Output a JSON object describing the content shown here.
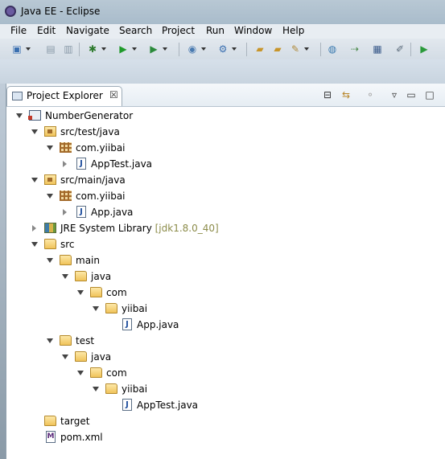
{
  "window": {
    "title": "Java EE - Eclipse"
  },
  "menu": [
    "File",
    "Edit",
    "Navigate",
    "Search",
    "Project",
    "Run",
    "Window",
    "Help"
  ],
  "toolbar": {
    "icons": [
      "new-icon",
      "save-icon",
      "save-all-icon",
      "debug-icon",
      "run-icon",
      "external-tools-icon",
      "new-server-icon",
      "web-service-icon",
      "open-folder-icon",
      "open-type-icon",
      "search-icon",
      "globe-icon",
      "next-annotation-icon",
      "console-icon",
      "pin-icon",
      "perspective-icon"
    ]
  },
  "view": {
    "tab_label": "Project Explorer",
    "close_glyph": "☒"
  },
  "tree": [
    {
      "label": "NumberGenerator",
      "icon": "project"
    },
    {
      "label": "src/test/java",
      "icon": "pkgroot"
    },
    {
      "label": "com.yiibai",
      "icon": "package"
    },
    {
      "label": "AppTest.java",
      "icon": "java"
    },
    {
      "label": "src/main/java",
      "icon": "pkgroot"
    },
    {
      "label": "com.yiibai",
      "icon": "package"
    },
    {
      "label": "App.java",
      "icon": "java"
    },
    {
      "label": "JRE System Library",
      "decoration": "[jdk1.8.0_40]",
      "icon": "library"
    },
    {
      "label": "src",
      "icon": "folder"
    },
    {
      "label": "main",
      "icon": "folder"
    },
    {
      "label": "java",
      "icon": "folder"
    },
    {
      "label": "com",
      "icon": "folder"
    },
    {
      "label": "yiibai",
      "icon": "folder"
    },
    {
      "label": "App.java",
      "icon": "java"
    },
    {
      "label": "test",
      "icon": "folder"
    },
    {
      "label": "java",
      "icon": "folder"
    },
    {
      "label": "com",
      "icon": "folder"
    },
    {
      "label": "yiibai",
      "icon": "folder"
    },
    {
      "label": "AppTest.java",
      "icon": "java"
    },
    {
      "label": "target",
      "icon": "folder"
    },
    {
      "label": "pom.xml",
      "icon": "xml"
    }
  ]
}
